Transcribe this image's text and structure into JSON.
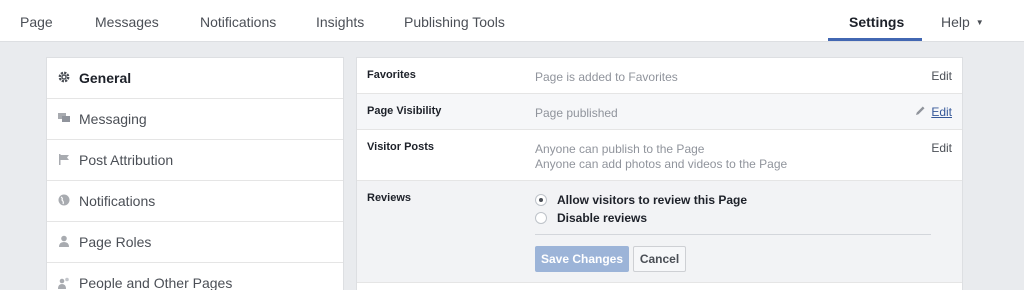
{
  "topnav": {
    "tabs": [
      {
        "label": "Page"
      },
      {
        "label": "Messages"
      },
      {
        "label": "Notifications"
      },
      {
        "label": "Insights"
      },
      {
        "label": "Publishing Tools"
      }
    ],
    "settings_label": "Settings",
    "help_label": "Help",
    "help_caret": "▼",
    "active_accent": "#4267b2"
  },
  "sidebar": {
    "items": [
      {
        "label": "General",
        "icon": "gear-icon",
        "active": true
      },
      {
        "label": "Messaging",
        "icon": "messaging-icon"
      },
      {
        "label": "Post Attribution",
        "icon": "flag-icon"
      },
      {
        "label": "Notifications",
        "icon": "globe-icon"
      },
      {
        "label": "Page Roles",
        "icon": "person-icon"
      },
      {
        "label": "People and Other Pages",
        "icon": "people-icon"
      }
    ]
  },
  "settings": {
    "rows": [
      {
        "label": "Favorites",
        "value": "Page is added to Favorites",
        "edit": "Edit"
      },
      {
        "label": "Page Visibility",
        "value": "Page published",
        "edit": "Edit"
      },
      {
        "label": "Visitor Posts",
        "value_line1": "Anyone can publish to the Page",
        "value_line2": "Anyone can add photos and videos to the Page",
        "edit": "Edit"
      }
    ],
    "reviews": {
      "label": "Reviews",
      "option_allow": "Allow visitors to review this Page",
      "option_disable": "Disable reviews",
      "selected": "Allow visitors to review this Page",
      "save_label": "Save Changes",
      "cancel_label": "Cancel"
    }
  }
}
